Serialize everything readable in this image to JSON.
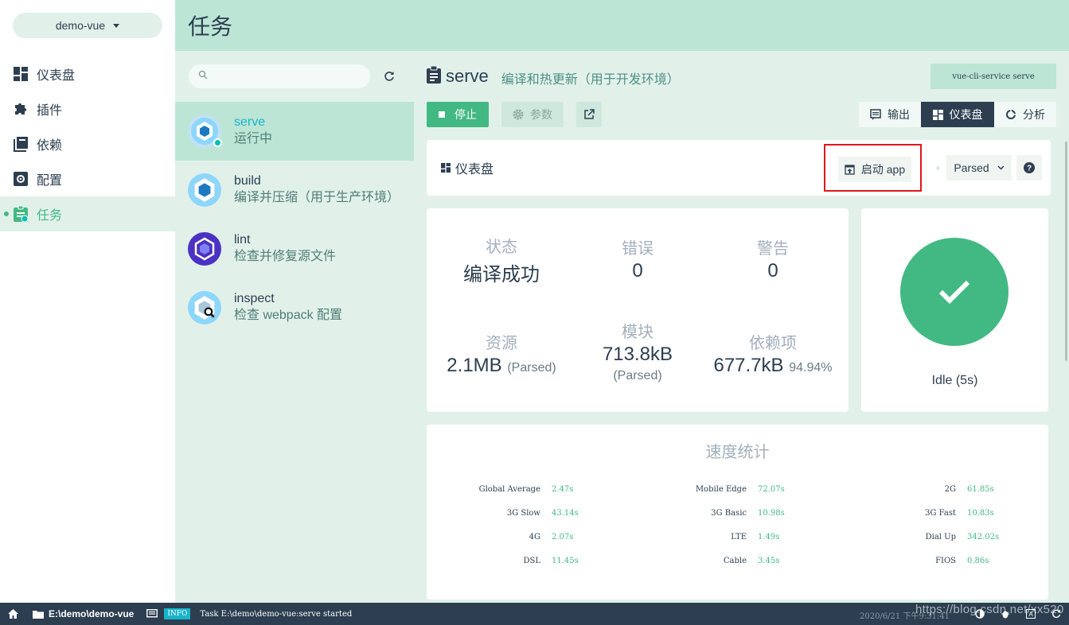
{
  "project": {
    "name": "demo-vue"
  },
  "nav": {
    "items": [
      {
        "label": "仪表盘",
        "icon": "dashboard-icon"
      },
      {
        "label": "插件",
        "icon": "puzzle-icon"
      },
      {
        "label": "依赖",
        "icon": "library-icon"
      },
      {
        "label": "配置",
        "icon": "settings-icon"
      },
      {
        "label": "任务",
        "icon": "assignment-icon",
        "active": true
      }
    ]
  },
  "header": {
    "title": "任务"
  },
  "search": {
    "placeholder": ""
  },
  "tasks": [
    {
      "name": "serve",
      "desc": "运行中",
      "active": true,
      "icon": "webpack-icon"
    },
    {
      "name": "build",
      "desc": "编译并压缩（用于生产环境）",
      "icon": "webpack-icon"
    },
    {
      "name": "lint",
      "desc": "检查并修复源文件",
      "icon": "eslint-icon"
    },
    {
      "name": "inspect",
      "desc": "检查 webpack 配置",
      "icon": "webpack-inspect-icon"
    }
  ],
  "task_detail": {
    "title": "serve",
    "subtitle": "编译和热更新（用于开发环境）",
    "command": "vue-cli-service serve",
    "stop_label": "停止",
    "params_label": "参数"
  },
  "views": {
    "output": "输出",
    "dashboard": "仪表盘",
    "analyze": "分析"
  },
  "dashboard": {
    "label": "仪表盘",
    "launch_label": "启动 app",
    "mode": "Parsed"
  },
  "stats": {
    "status": {
      "label": "状态",
      "value": "编译成功"
    },
    "errors": {
      "label": "错误",
      "value": "0"
    },
    "warnings": {
      "label": "警告",
      "value": "0"
    },
    "assets": {
      "label": "资源",
      "value": "2.1MB",
      "note": "(Parsed)"
    },
    "modules": {
      "label": "模块",
      "value": "713.8kB",
      "note": "(Parsed)"
    },
    "deps": {
      "label": "依赖项",
      "value": "677.7kB",
      "note": "94.94%"
    }
  },
  "build_status": {
    "text": "Idle (5s)",
    "color": "#42b983"
  },
  "speed": {
    "title": "速度统计",
    "rows": [
      [
        {
          "name": "Global Average",
          "time": "2.47s"
        },
        {
          "name": "Mobile Edge",
          "time": "72.07s"
        },
        {
          "name": "2G",
          "time": "61.85s"
        }
      ],
      [
        {
          "name": "3G Slow",
          "time": "43.14s"
        },
        {
          "name": "3G Basic",
          "time": "10.98s"
        },
        {
          "name": "3G Fast",
          "time": "10.83s"
        }
      ],
      [
        {
          "name": "4G",
          "time": "2.07s"
        },
        {
          "name": "LTE",
          "time": "1.49s"
        },
        {
          "name": "Dial Up",
          "time": "342.02s"
        }
      ],
      [
        {
          "name": "DSL",
          "time": "11.45s"
        },
        {
          "name": "Cable",
          "time": "3.45s"
        },
        {
          "name": "FIOS",
          "time": "0.86s"
        }
      ]
    ]
  },
  "statusbar": {
    "path": "E:\\demo\\demo-vue",
    "badge": "INFO",
    "message": "Task E:\\demo\\demo-vue:serve started",
    "time": "2020/6/21  下午9:31:41",
    "watermark": "https://blog.csdn.net/xx520"
  },
  "colors": {
    "accent": "#42b983",
    "dark": "#2c3e50",
    "header_bg": "#bde5d5",
    "panel_bg": "#e1f1ea",
    "highlight": "#e0161b"
  }
}
